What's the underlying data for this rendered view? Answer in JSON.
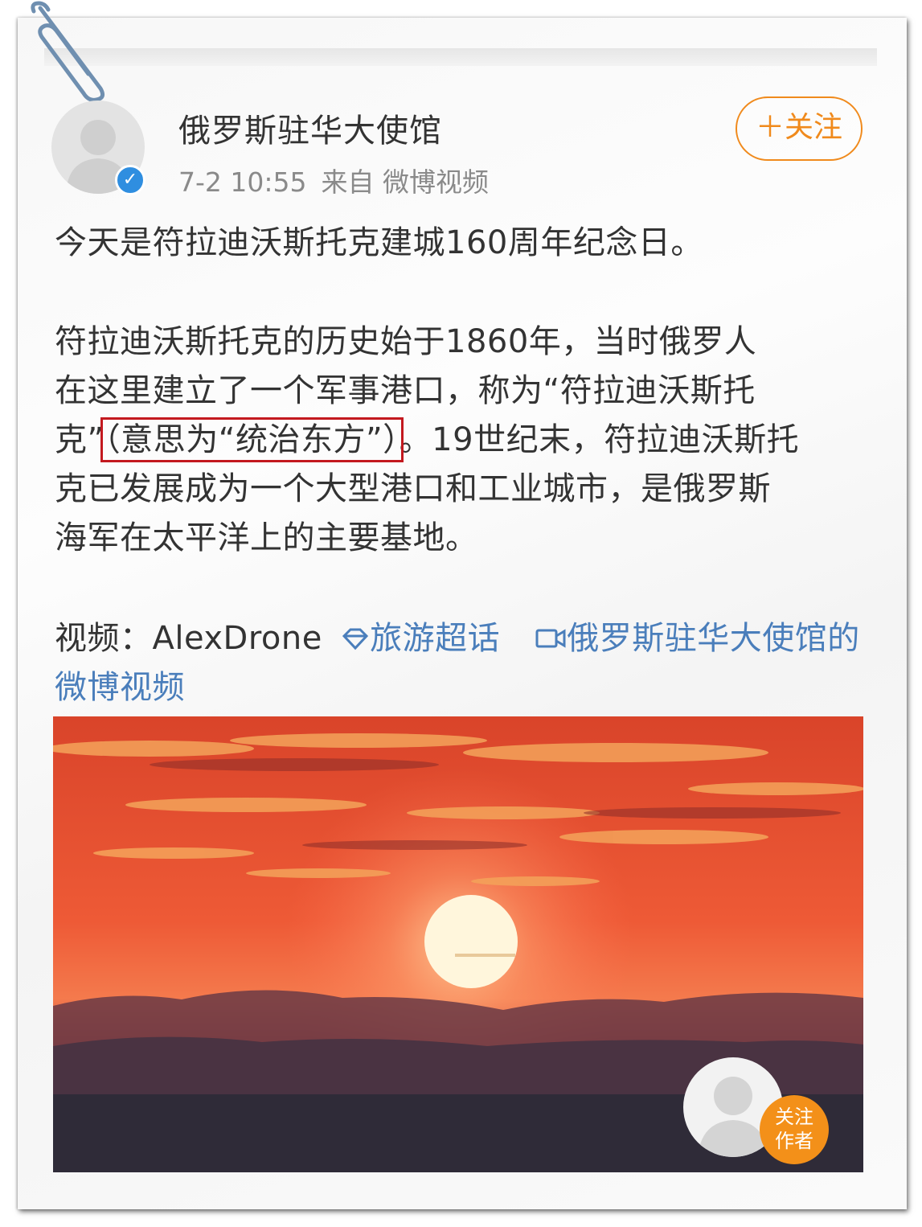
{
  "post": {
    "author": "俄罗斯驻华大使馆",
    "time": "7-2 10:55",
    "source": "来自 微博视频",
    "follow_label": "＋关注",
    "para1": "今天是符拉迪沃斯托克建城160周年纪念日。",
    "para2_line1": "符拉迪沃斯托克的历史始于1860年，当时俄罗人",
    "para2_line2": "在这里建立了一个军事港口，称为“符拉迪沃斯托",
    "para2_line3_a": "克”",
    "para2_line3_highlight": "（意思为“统治东方”）",
    "para2_line3_b": "。19世纪末，符拉迪沃斯托",
    "para2_line4": "克已发展成为一个大型港口和工业城市，是俄罗斯",
    "para2_line5": "海军在太平洋上的主要基地。",
    "video_credit": "视频：AlexDrone",
    "topic_link": "旅游超话",
    "video_link": "俄罗斯驻华大使馆的微博视频"
  },
  "player": {
    "follow_author_line1": "关注",
    "follow_author_line2": "作者"
  },
  "colors": {
    "accent": "#f08a1c",
    "link": "#4a7ebb",
    "highlight_box": "#c3191f",
    "verified": "#2f8ee0"
  },
  "icons": [
    "paperclip-icon",
    "verified-icon",
    "topic-icon",
    "video-icon"
  ]
}
